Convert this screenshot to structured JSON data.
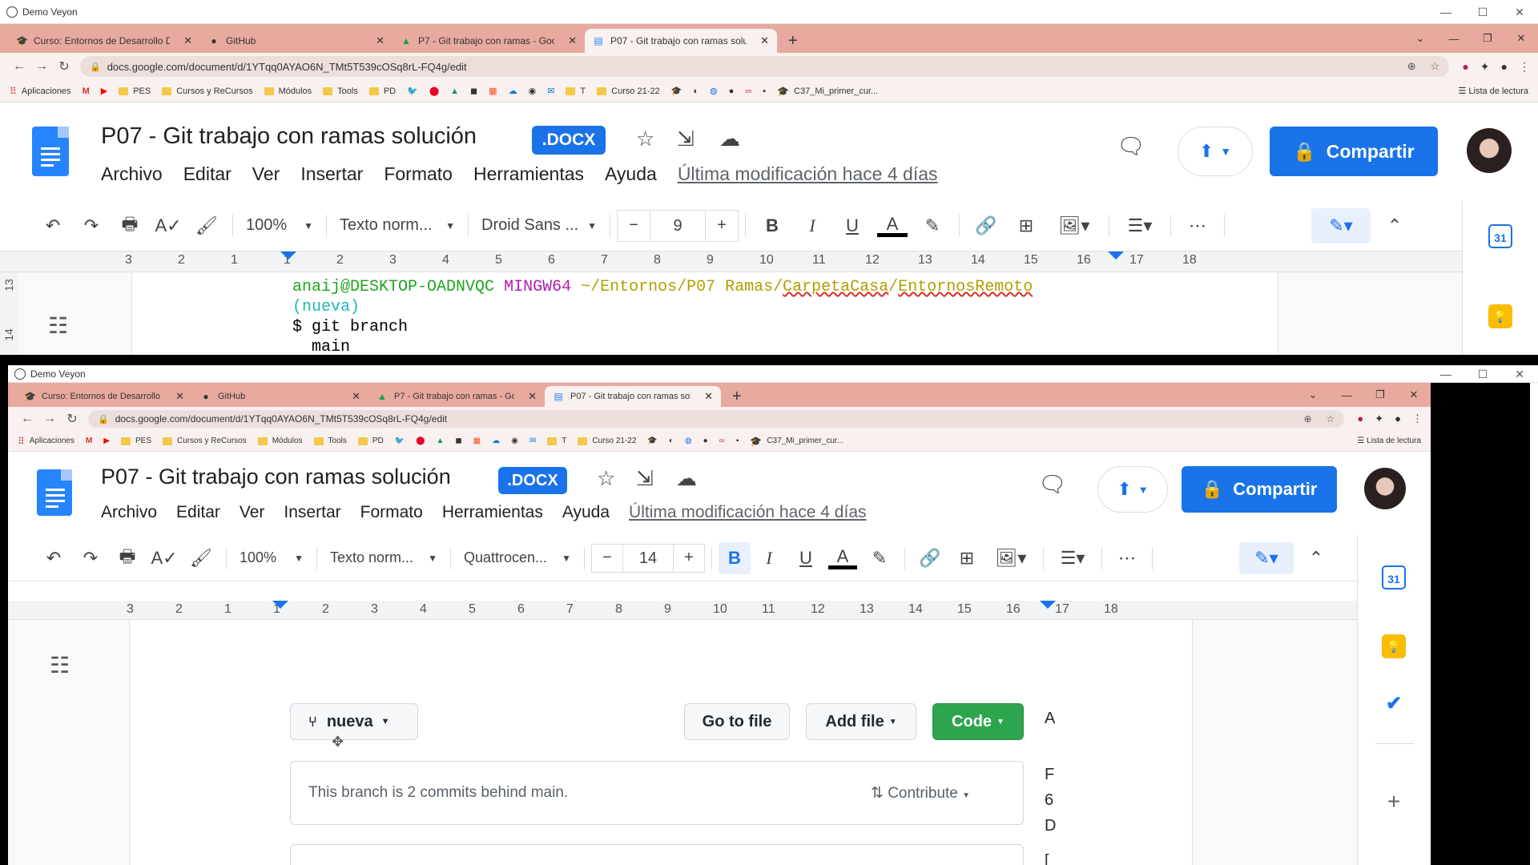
{
  "window_title": "Demo Veyon",
  "tabs": [
    {
      "label": "Curso: Entornos de Desarrollo DA",
      "icon": "moodle-icon"
    },
    {
      "label": "GitHub",
      "icon": "github-icon"
    },
    {
      "label": "P7 - Git trabajo con ramas - Goo",
      "icon": "drive-icon"
    },
    {
      "label": "P07 - Git trabajo con ramas soluc",
      "icon": "docs-icon"
    }
  ],
  "url": "docs.google.com/document/d/1YTqq0AYAO6N_TMt5T539cOSq8rL-FQ4g/edit",
  "bookmarks": [
    "Aplicaciones",
    "PES",
    "Cursos y ReCursos",
    "Módulos",
    "Tools",
    "PD",
    "T",
    "Curso 21-22",
    "C37_Mi_primer_cur..."
  ],
  "reading_list": "Lista de lectura",
  "doc": {
    "title": "P07 - Git trabajo con ramas solución",
    "badge": ".DOCX",
    "menu": [
      "Archivo",
      "Editar",
      "Ver",
      "Insertar",
      "Formato",
      "Herramientas",
      "Ayuda"
    ],
    "last_modified": "Última modificación hace 4 días",
    "share_label": "Compartir"
  },
  "toolbar1": {
    "zoom": "100%",
    "style": "Texto norm...",
    "font": "Droid Sans ...",
    "size": "9"
  },
  "toolbar2": {
    "zoom": "100%",
    "style": "Texto norm...",
    "font": "Quattrocen...",
    "size": "14"
  },
  "ruler_top": [
    "3",
    "2",
    "1",
    "1",
    "2",
    "3",
    "4",
    "5",
    "6",
    "7",
    "8",
    "9",
    "10",
    "11",
    "12",
    "13",
    "14",
    "15",
    "16",
    "17",
    "18"
  ],
  "ruler_side": [
    "13",
    "14"
  ],
  "calendar_day": "31",
  "terminal": {
    "user": "anaij@DESKTOP-OADNVQC",
    "shell": "MINGW64",
    "path_prefix": "~/Entornos/P07 Ramas/",
    "path_a": "CarpetaCasa",
    "path_sep": "/",
    "path_b": "EntornosRemoto",
    "branch": "(nueva)",
    "command": "$ git branch",
    "output": "  main"
  },
  "github": {
    "branch": "nueva",
    "go_to_file": "Go to file",
    "add_file": "Add file",
    "code": "Code",
    "notice": "This branch is 2 commits behind main.",
    "contribute": "Contribute",
    "side_letters": [
      "A",
      "F",
      "6",
      "D",
      "["
    ]
  }
}
